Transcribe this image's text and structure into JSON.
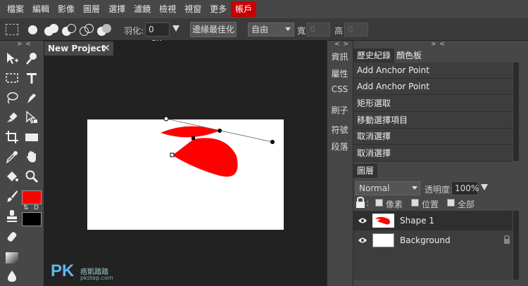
{
  "menu": [
    "檔案",
    "編輯",
    "影像",
    "圖層",
    "選擇",
    "濾鏡",
    "檢視",
    "視窗",
    "更多",
    "帳戶"
  ],
  "options": {
    "feather_label": "羽化:",
    "feather_value": "0",
    "feather_unit": "px",
    "refine_edge_label": "邊緣最佳化",
    "style_value": "自由",
    "width_label": "寬",
    "width_value": "0",
    "height_label": "高",
    "height_value": "0"
  },
  "document": {
    "tab_title": "New Project",
    "close_glyph": "✕"
  },
  "mini_panel": [
    "資訊",
    "屬性",
    "CSS",
    "刷子",
    "符號",
    "段落"
  ],
  "collapse_glyphs": {
    "left": "> <",
    "mini": "< >",
    "right": "> <"
  },
  "history_panel": {
    "tabs": [
      "歷史紀錄",
      "顏色板"
    ],
    "items": [
      "Add Anchor Point",
      "Add Anchor Point",
      "矩形選取",
      "移動選擇項目",
      "取消選擇",
      "取消選擇"
    ]
  },
  "layers_panel": {
    "title": "圖層",
    "blend_mode": "Normal",
    "opacity_label": "透明度:",
    "opacity_value": "100%",
    "lock_options": [
      "像素",
      "位置",
      "全部"
    ],
    "layers": [
      {
        "name": "Shape 1",
        "selected": true,
        "locked": false
      },
      {
        "name": "Background",
        "selected": false,
        "locked": true
      }
    ]
  },
  "colors": {
    "foreground": "#ff0000",
    "background": "#000000",
    "shape_fill": "#ff0000",
    "account_menu": "#c80000"
  },
  "icons": [
    "marquee-icon",
    "move-icon",
    "lasso-icon",
    "pen-icon",
    "type-icon",
    "crop-icon",
    "eyedropper-icon",
    "hand-icon",
    "zoom-icon",
    "brush-icon",
    "stamp-icon",
    "gradient-icon",
    "eye-icon",
    "lock-icon"
  ],
  "watermark": {
    "brand": "PK",
    "text": "痞凱踏踏",
    "url": "pkstep.com"
  }
}
